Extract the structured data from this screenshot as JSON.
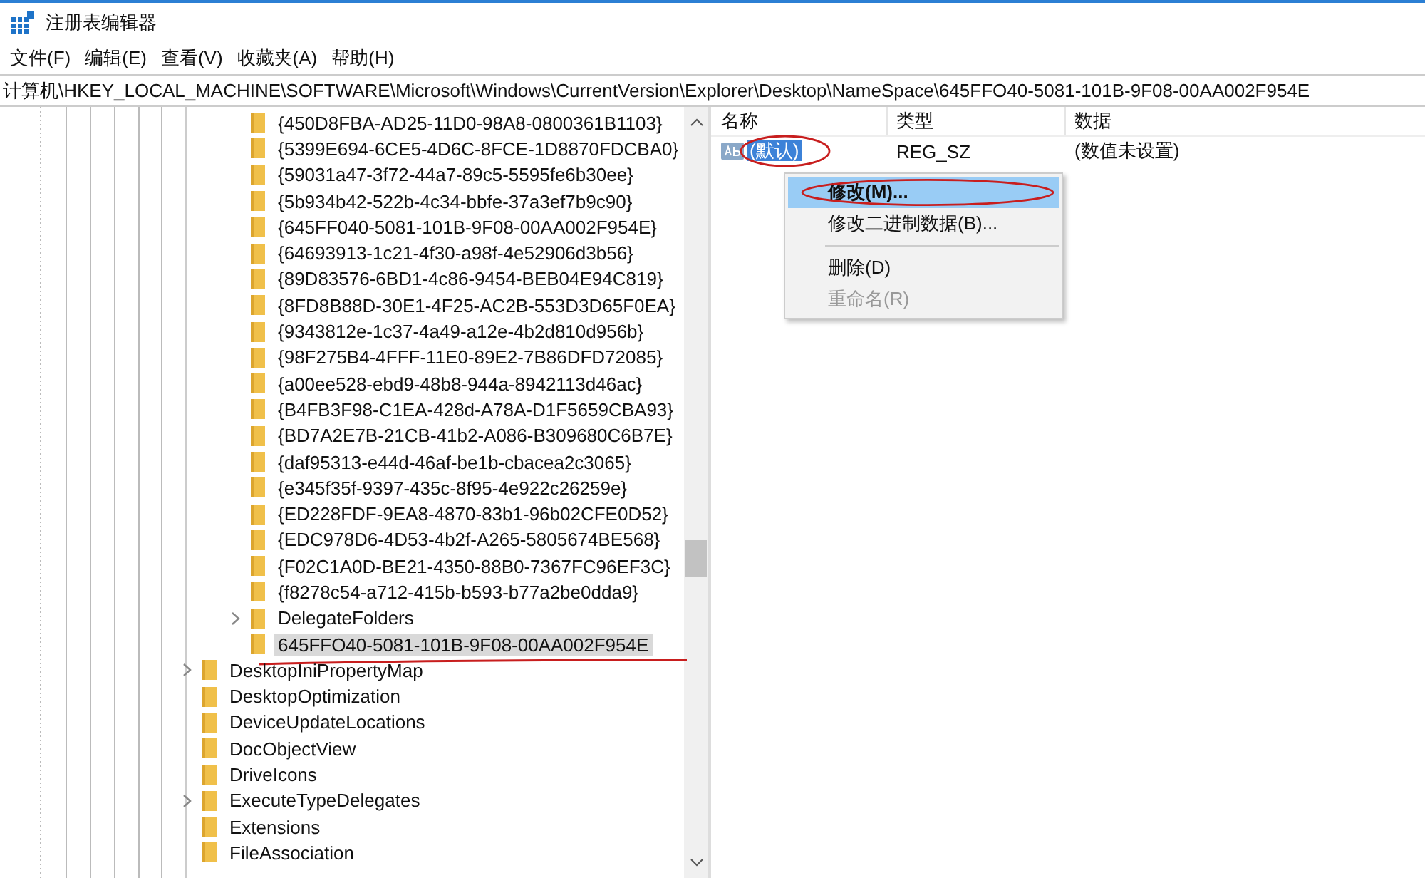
{
  "window": {
    "title": "注册表编辑器"
  },
  "menu": [
    "文件(F)",
    "编辑(E)",
    "查看(V)",
    "收藏夹(A)",
    "帮助(H)"
  ],
  "address": "计算机\\HKEY_LOCAL_MACHINE\\SOFTWARE\\Microsoft\\Windows\\CurrentVersion\\Explorer\\Desktop\\NameSpace\\645FFO40-5081-101B-9F08-00AA002F954E",
  "tree": {
    "items": [
      {
        "children": [
          {
            "children": [
              {
                "label": "{450D8FBA-AD25-11D0-98A8-0800361B1103}",
                "expandable": false,
                "selected": false
              },
              {
                "label": "{5399E694-6CE5-4D6C-8FCE-1D8870FDCBA0}",
                "expandable": false,
                "selected": false
              },
              {
                "label": "{59031a47-3f72-44a7-89c5-5595fe6b30ee}",
                "expandable": false,
                "selected": false
              },
              {
                "label": "{5b934b42-522b-4c34-bbfe-37a3ef7b9c90}",
                "expandable": false,
                "selected": false
              },
              {
                "label": "{645FF040-5081-101B-9F08-00AA002F954E}",
                "expandable": false,
                "selected": false
              },
              {
                "label": "{64693913-1c21-4f30-a98f-4e52906d3b56}",
                "expandable": false,
                "selected": false
              },
              {
                "label": "{89D83576-6BD1-4c86-9454-BEB04E94C819}",
                "expandable": false,
                "selected": false
              },
              {
                "label": "{8FD8B88D-30E1-4F25-AC2B-553D3D65F0EA}",
                "expandable": false,
                "selected": false
              },
              {
                "label": "{9343812e-1c37-4a49-a12e-4b2d810d956b}",
                "expandable": false,
                "selected": false
              },
              {
                "label": "{98F275B4-4FFF-11E0-89E2-7B86DFD72085}",
                "expandable": false,
                "selected": false
              },
              {
                "label": "{a00ee528-ebd9-48b8-944a-8942113d46ac}",
                "expandable": false,
                "selected": false
              },
              {
                "label": "{B4FB3F98-C1EA-428d-A78A-D1F5659CBA93}",
                "expandable": false,
                "selected": false
              },
              {
                "label": "{BD7A2E7B-21CB-41b2-A086-B309680C6B7E}",
                "expandable": false,
                "selected": false
              },
              {
                "label": "{daf95313-e44d-46af-be1b-cbacea2c3065}",
                "expandable": false,
                "selected": false
              },
              {
                "label": "{e345f35f-9397-435c-8f95-4e922c26259e}",
                "expandable": false,
                "selected": false
              },
              {
                "label": "{ED228FDF-9EA8-4870-83b1-96b02CFE0D52}",
                "expandable": false,
                "selected": false
              },
              {
                "label": "{EDC978D6-4D53-4b2f-A265-5805674BE568}",
                "expandable": false,
                "selected": false
              },
              {
                "label": "{F02C1A0D-BE21-4350-88B0-7367FC96EF3C}",
                "expandable": false,
                "selected": false
              },
              {
                "label": "{f8278c54-a712-415b-b593-b77a2be0dda9}",
                "expandable": false,
                "selected": false
              },
              {
                "label": "DelegateFolders",
                "expandable": true,
                "selected": false
              },
              {
                "label": "645FFO40-5081-101B-9F08-00AA002F954E",
                "expandable": false,
                "selected": true
              }
            ]
          }
        ]
      },
      {
        "label": "DesktopIniPropertyMap",
        "expandable": true,
        "selected": false
      },
      {
        "label": "DesktopOptimization",
        "expandable": false,
        "selected": false
      },
      {
        "label": "DeviceUpdateLocations",
        "expandable": false,
        "selected": false
      },
      {
        "label": "DocObjectView",
        "expandable": false,
        "selected": false
      },
      {
        "label": "DriveIcons",
        "expandable": false,
        "selected": false
      },
      {
        "label": "ExecuteTypeDelegates",
        "expandable": true,
        "selected": false
      },
      {
        "label": "Extensions",
        "expandable": false,
        "selected": false
      },
      {
        "label": "FileAssociation",
        "expandable": false,
        "selected": false
      }
    ]
  },
  "values": {
    "columns": [
      "名称",
      "类型",
      "数据"
    ],
    "rows": [
      {
        "name": "(默认)",
        "type": "REG_SZ",
        "data": "(数值未设置)",
        "selected": true
      }
    ]
  },
  "context_menu": [
    {
      "kind": "item",
      "label": "修改(M)...",
      "selected": true,
      "disabled": false,
      "bold": true
    },
    {
      "kind": "item",
      "label": "修改二进制数据(B)...",
      "selected": false,
      "disabled": false,
      "bold": false
    },
    {
      "kind": "separator"
    },
    {
      "kind": "item",
      "label": "删除(D)",
      "selected": false,
      "disabled": false,
      "bold": false
    },
    {
      "kind": "item",
      "label": "重命名(R)",
      "selected": false,
      "disabled": true,
      "bold": false
    }
  ]
}
